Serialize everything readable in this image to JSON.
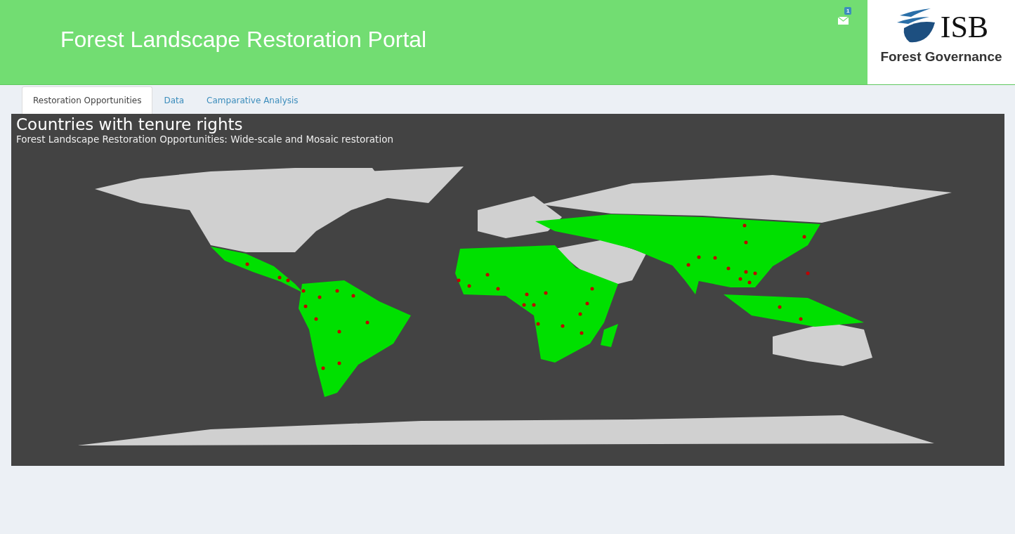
{
  "header": {
    "title": "Forest Landscape Restoration Portal",
    "messages_badge": "1",
    "logo": {
      "name": "ISB",
      "subtitle": "Forest Governance"
    }
  },
  "tabs": [
    {
      "label": "Restoration Opportunities",
      "selected": true
    },
    {
      "label": "Data",
      "selected": false
    },
    {
      "label": "Camparative Analysis",
      "selected": false
    }
  ],
  "map_panel": {
    "title": "Countries with tenure rights",
    "subtitle": "Forest Landscape Restoration Opportunities: Wide-scale and Mosaic restoration"
  }
}
